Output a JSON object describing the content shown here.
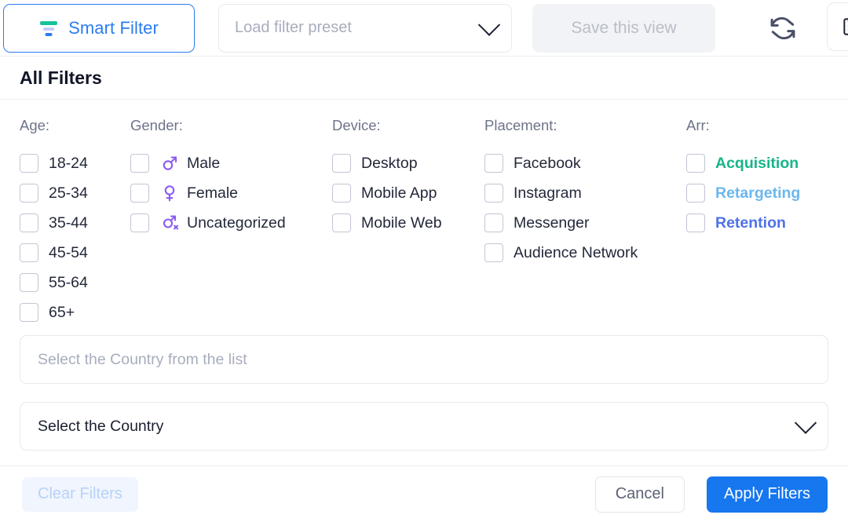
{
  "toolbar": {
    "smart_filter_label": "Smart Filter",
    "smart_filter_icon": "funnel-icon",
    "preset_placeholder": "Load filter preset",
    "preset_chevron_icon": "chevron-down-icon",
    "save_view_label": "Save this view",
    "refresh_icon": "refresh-sync-icon",
    "clipboard_icon": "clipboard-list-icon"
  },
  "section": {
    "title": "All Filters"
  },
  "columns": [
    {
      "key": "age",
      "title": "Age:",
      "options": [
        {
          "label": "18-24",
          "checked": false
        },
        {
          "label": "25-34",
          "checked": false
        },
        {
          "label": "35-44",
          "checked": false
        },
        {
          "label": "45-54",
          "checked": false
        },
        {
          "label": "55-64",
          "checked": false
        },
        {
          "label": "65+",
          "checked": false
        }
      ]
    },
    {
      "key": "gender",
      "title": "Gender:",
      "options": [
        {
          "label": "Male",
          "icon": "male-gender-icon",
          "checked": false
        },
        {
          "label": "Female",
          "icon": "female-gender-icon",
          "checked": false
        },
        {
          "label": "Uncategorized",
          "icon": "uncategorized-gender-icon",
          "checked": false
        }
      ]
    },
    {
      "key": "device",
      "title": "Device:",
      "options": [
        {
          "label": "Desktop",
          "checked": false
        },
        {
          "label": "Mobile App",
          "checked": false
        },
        {
          "label": "Mobile Web",
          "checked": false
        }
      ]
    },
    {
      "key": "placement",
      "title": "Placement:",
      "options": [
        {
          "label": "Facebook",
          "checked": false
        },
        {
          "label": "Instagram",
          "checked": false
        },
        {
          "label": "Messenger",
          "checked": false
        },
        {
          "label": "Audience Network",
          "checked": false
        }
      ]
    },
    {
      "key": "arr",
      "title": "Arr:",
      "options": [
        {
          "label": "Acquisition",
          "checked": false,
          "color": "#17b58a"
        },
        {
          "label": "Retargeting",
          "checked": false,
          "color": "#6cb7ef"
        },
        {
          "label": "Retention",
          "checked": false,
          "color": "#4f72e8"
        }
      ]
    }
  ],
  "country_search": {
    "placeholder": "Select the Country from the list",
    "value": ""
  },
  "country_select": {
    "value": "Select the Country",
    "chevron_icon": "chevron-down-icon"
  },
  "footer": {
    "clear_label": "Clear Filters",
    "cancel_label": "Cancel",
    "apply_label": "Apply Filters"
  },
  "colors": {
    "primary_blue": "#1677ef",
    "smart_border": "#2b7cf0",
    "acquisition": "#17b58a",
    "retargeting": "#6cb7ef",
    "retention": "#4f72e8",
    "gender_purple": "#8b5cf0"
  }
}
